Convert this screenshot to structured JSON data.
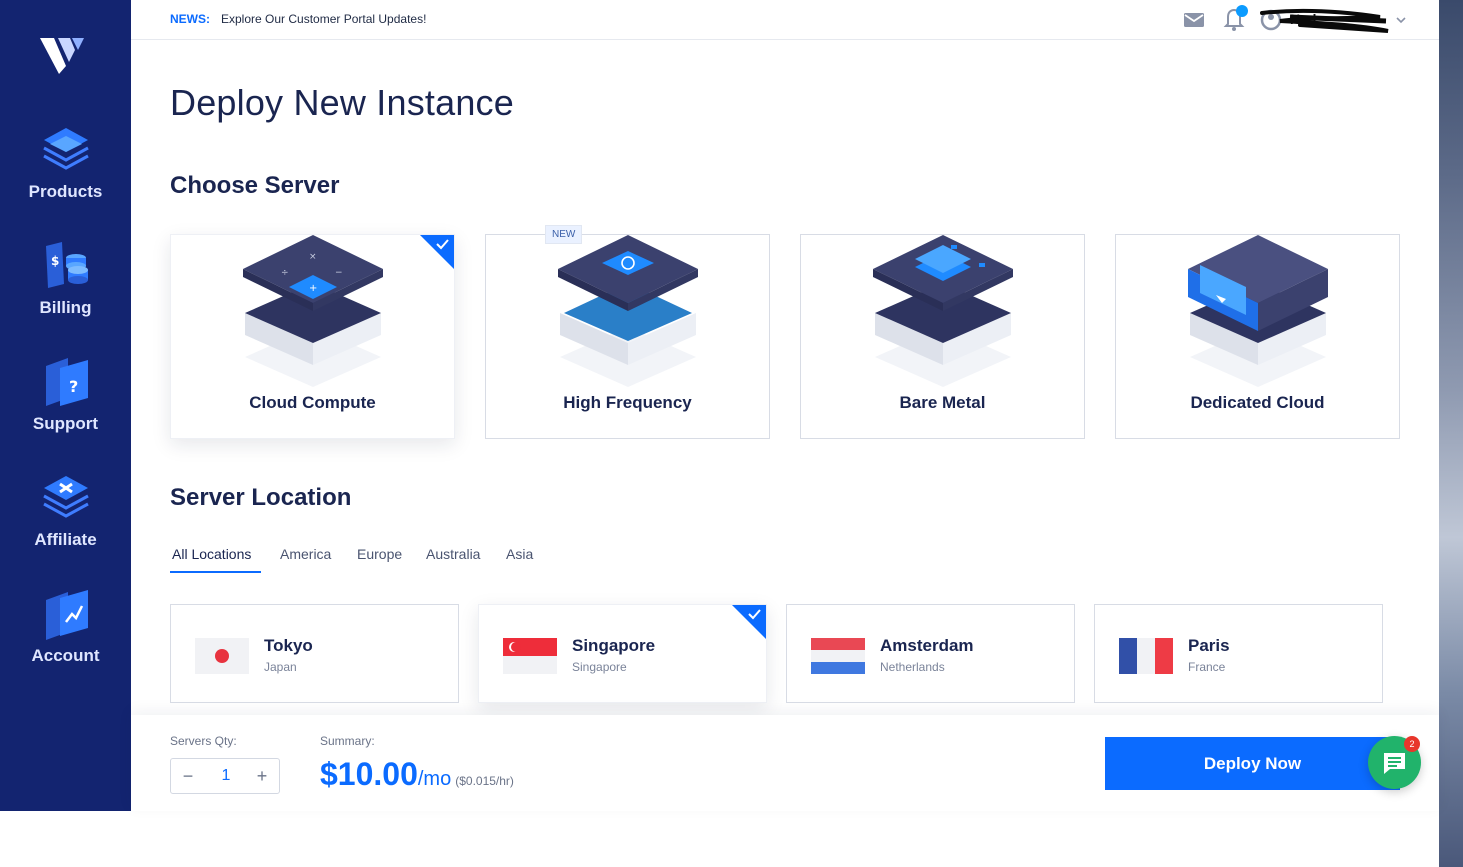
{
  "sidebar": {
    "brand_color": "#132470",
    "logo_icon": "vultr-logo-icon",
    "items": [
      {
        "label": "Products",
        "icon": "layers-icon"
      },
      {
        "label": "Billing",
        "icon": "billing-icon"
      },
      {
        "label": "Support",
        "icon": "support-icon"
      },
      {
        "label": "Affiliate",
        "icon": "affiliate-icon"
      },
      {
        "label": "Account",
        "icon": "account-icon"
      }
    ]
  },
  "topbar": {
    "news_tag": "NEWS:",
    "news_text": "Explore Our Customer Portal Updates!",
    "mail_icon": "mail-icon",
    "bell_icon": "bell-icon",
    "user_icon": "user-icon",
    "user_name": "Nad",
    "dropdown_icon": "chevron-down-icon"
  },
  "page": {
    "title": "Deploy New Instance"
  },
  "choose_server": {
    "title": "Choose Server",
    "selected": "Cloud Compute",
    "cards": [
      {
        "label": "Cloud Compute",
        "selected": true,
        "badge": ""
      },
      {
        "label": "High Frequency",
        "selected": false,
        "badge": "NEW"
      },
      {
        "label": "Bare Metal",
        "selected": false,
        "badge": ""
      },
      {
        "label": "Dedicated Cloud",
        "selected": false,
        "badge": ""
      }
    ]
  },
  "server_location": {
    "title": "Server Location",
    "tabs": [
      {
        "label": "All Locations",
        "active": true
      },
      {
        "label": "America",
        "active": false
      },
      {
        "label": "Europe",
        "active": false
      },
      {
        "label": "Australia",
        "active": false
      },
      {
        "label": "Asia",
        "active": false
      }
    ],
    "locations": [
      {
        "city": "Tokyo",
        "country": "Japan",
        "flag": "japan-flag-icon",
        "selected": false
      },
      {
        "city": "Singapore",
        "country": "Singapore",
        "flag": "singapore-flag-icon",
        "selected": true
      },
      {
        "city": "Amsterdam",
        "country": "Netherlands",
        "flag": "netherlands-flag-icon",
        "selected": false
      },
      {
        "city": "Paris",
        "country": "France",
        "flag": "france-flag-icon",
        "selected": false
      }
    ]
  },
  "bottom_bar": {
    "qty_label": "Servers Qty:",
    "qty_value": "1",
    "minus": "−",
    "plus": "+",
    "summary_label": "Summary:",
    "price_amount": "$10.00",
    "price_period": "/mo",
    "price_hourly": "($0.015/hr)",
    "deploy_label": "Deploy Now"
  },
  "chat": {
    "icon": "chat-icon",
    "badge_count": "2"
  },
  "colors": {
    "accent": "#0b6bff",
    "sidebar": "#132470",
    "chat": "#21b36b"
  }
}
